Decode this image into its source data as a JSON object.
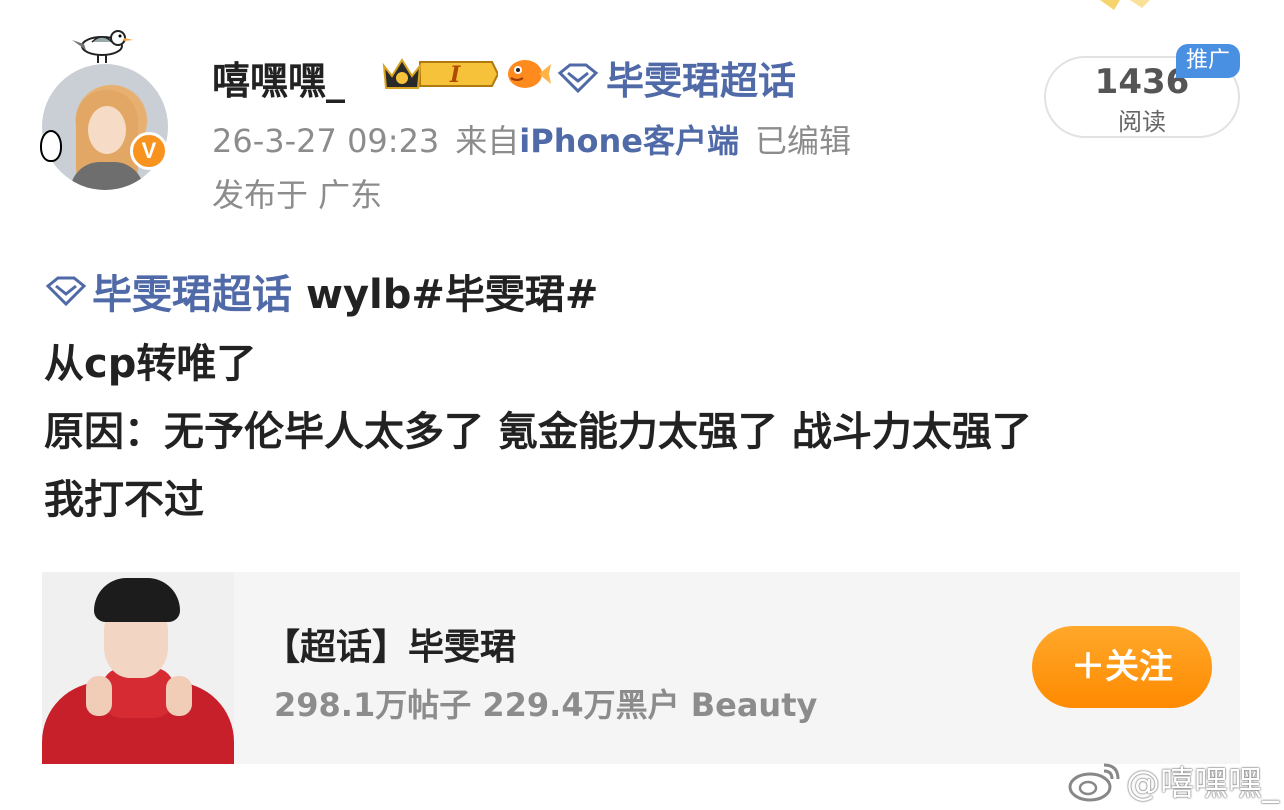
{
  "user": {
    "name": "嘻嘿嘿_",
    "level_badge": "I",
    "avatar_verified_letter": "V"
  },
  "header_topic": {
    "label": "毕雯珺超话"
  },
  "meta": {
    "datetime": "26-3-27 09:23",
    "from_prefix": "来自",
    "client": "iPhone客户端",
    "edited": "已编辑",
    "location": "发布于 广东"
  },
  "read": {
    "count": "1436",
    "label": "阅读",
    "promo": "推广"
  },
  "post": {
    "topic_link": "毕雯珺超话",
    "tag_text": "wylb#毕雯珺#",
    "body": "从cp转唯了\n原因：无予伦毕人太多了 氪金能力太强了 战斗力太强了\n我打不过"
  },
  "card": {
    "title": "【超话】毕雯珺",
    "subtitle": "298.1万帖子 229.4万黑户 Beauty",
    "follow_label": "＋关注"
  },
  "watermark": {
    "text": "@嘻嘿嘿_"
  },
  "colors": {
    "link": "#506aa8",
    "follow_orange": "#ff9a14",
    "badge_blue": "#4a90e2",
    "verified_orange": "#f7931e"
  }
}
